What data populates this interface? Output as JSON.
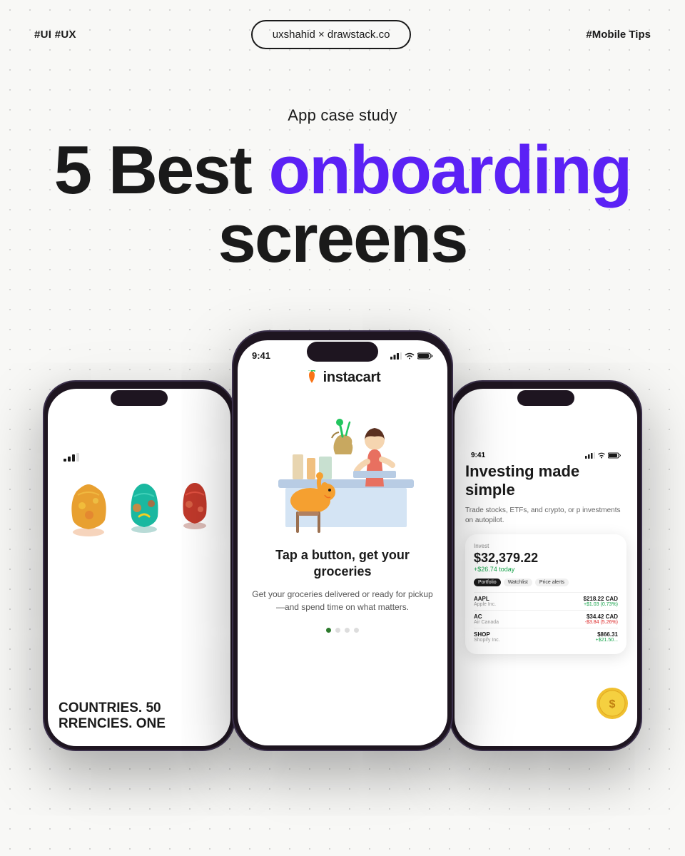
{
  "header": {
    "tag_left": "#UI #UX",
    "brand": "uxshahid × drawstack.co",
    "tag_right": "#Mobile Tips"
  },
  "hero": {
    "subtitle": "App case study",
    "title_prefix": "5 Best ",
    "title_highlight": "onboarding",
    "title_suffix": "screens"
  },
  "phones": {
    "center": {
      "app": "instacart",
      "time": "9:41",
      "heading": "Tap a button, get your groceries",
      "body": "Get your groceries delivered or ready for pickup—and spend time on what matters.",
      "dots": [
        true,
        false,
        false,
        false
      ]
    },
    "left": {
      "time": "",
      "bottom_text_line1": "COUNTRIES. 50",
      "bottom_text_line2": "RRENCIES. ONE"
    },
    "right": {
      "time": "9:41",
      "heading": "Investing made simple",
      "subtext": "Trade stocks, ETFs, and crypto, or p investments on autopilot.",
      "invest_label": "Invest",
      "invest_amount": "$32,379.22",
      "invest_change": "+$26.74 today",
      "tabs": [
        "Portfolio",
        "Watchlist",
        "Price alerts"
      ],
      "stocks": [
        {
          "ticker": "AAPL",
          "company": "Apple Inc.",
          "price": "$218.22 CAD",
          "change": "+$1.03 (0.73%)",
          "up": true
        },
        {
          "ticker": "AC",
          "company": "Air Canada",
          "price": "$34.42 CAD",
          "change": "-$3.84 (5.26%)",
          "up": false
        },
        {
          "ticker": "SHOP",
          "company": "Shopify Inc.",
          "price": "$866.31",
          "change": "+$21.50...",
          "up": true
        }
      ]
    }
  },
  "colors": {
    "accent_purple": "#5B21F5",
    "instacart_green": "#2d7a2d",
    "background": "#f8f8f6"
  }
}
